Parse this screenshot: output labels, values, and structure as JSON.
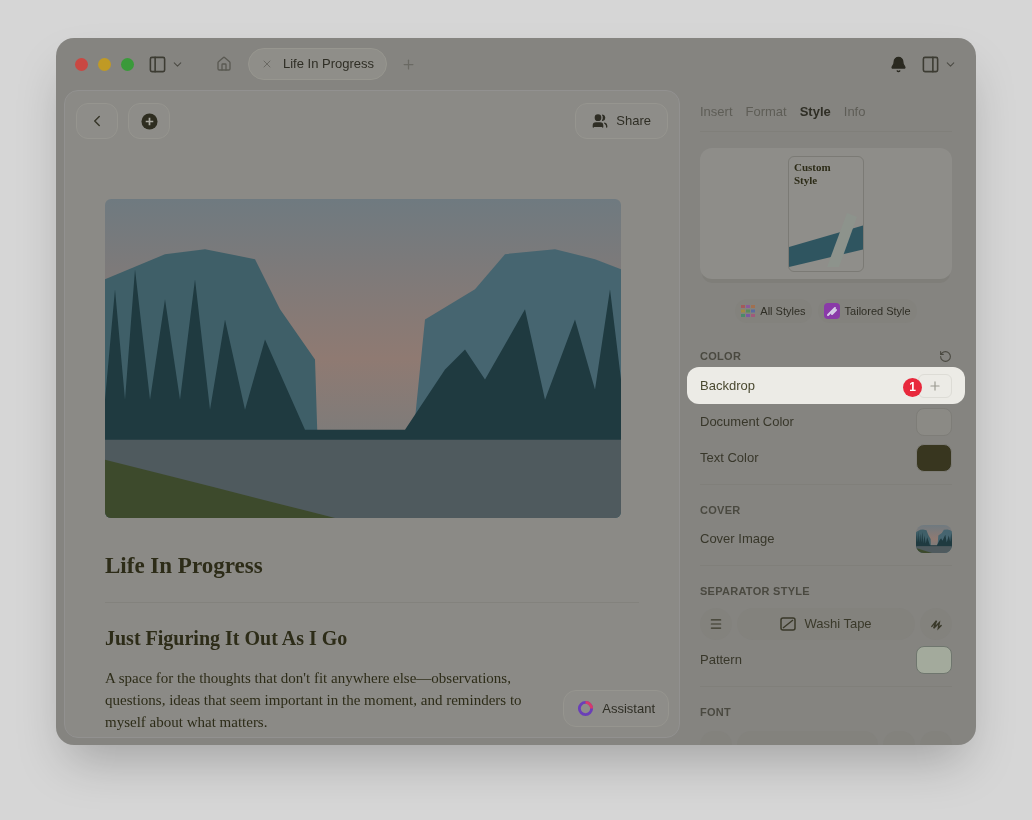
{
  "window": {
    "tab": {
      "title": "Life In Progress",
      "selected": true
    }
  },
  "editor": {
    "share": "Share",
    "title": "Life In Progress",
    "subtitle": "Just Figuring It Out As I Go",
    "body": "A space for the thoughts that don't fit anywhere else—observations, questions, ideas that seem important in the moment, and reminders to myself about what matters.",
    "assistant": "Assistant"
  },
  "sidebar": {
    "tabs": [
      {
        "label": "Insert",
        "selected": false
      },
      {
        "label": "Format",
        "selected": false
      },
      {
        "label": "Style",
        "selected": true
      },
      {
        "label": "Info",
        "selected": false
      }
    ],
    "preview": {
      "title": "Custom Style"
    },
    "style_buttons": [
      {
        "label": "All Styles",
        "kind": "grid"
      },
      {
        "label": "Tailored Style",
        "kind": "tailored"
      }
    ],
    "sections": [
      {
        "header": "COLOR",
        "reset": true,
        "rows": [
          {
            "kind": "add",
            "label": "Backdrop",
            "highlighted": true,
            "badge": "1"
          },
          {
            "kind": "swatch",
            "label": "Document Color",
            "highlighted": false,
            "color": "#8b8a85"
          },
          {
            "kind": "swatch",
            "label": "Text Color",
            "highlighted": false,
            "color": "#38361f"
          }
        ]
      },
      {
        "header": "COVER",
        "reset": false,
        "rows": [
          {
            "kind": "image",
            "label": "Cover Image",
            "highlighted": false
          }
        ]
      },
      {
        "header": "SEPARATOR STYLE",
        "reset": false,
        "rows": [
          {
            "kind": "segmented",
            "label": "Washi Tape"
          },
          {
            "kind": "pattern",
            "label": "Pattern",
            "highlighted": false
          }
        ]
      },
      {
        "header": "FONT",
        "reset": false,
        "rows": [
          {
            "kind": "cutoff"
          }
        ]
      }
    ]
  }
}
